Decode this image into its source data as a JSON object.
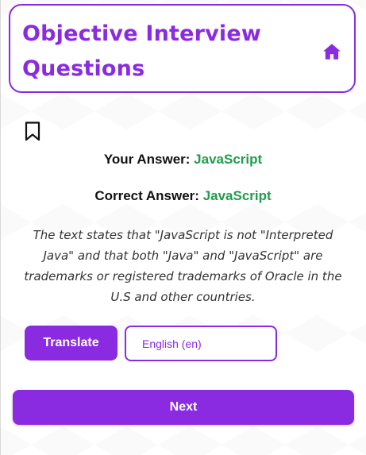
{
  "header": {
    "title": "Objective Interview Questions",
    "home_icon": "home-icon"
  },
  "bookmark_icon": "bookmark-icon",
  "your_answer": {
    "label": "Your Answer:",
    "value": "JavaScript"
  },
  "correct_answer": {
    "label": "Correct Answer:",
    "value": "JavaScript"
  },
  "explanation": "The text states that \"JavaScript is not \"Interpreted Java\" and that both \"Java\" and \"JavaScript\" are trademarks or registered trademarks of Oracle in the U.S and other countries.",
  "translate": {
    "button_label": "Translate",
    "language": "English (en)"
  },
  "next_label": "Next",
  "colors": {
    "accent": "#8a2be2",
    "correct": "#1f9d4c"
  }
}
